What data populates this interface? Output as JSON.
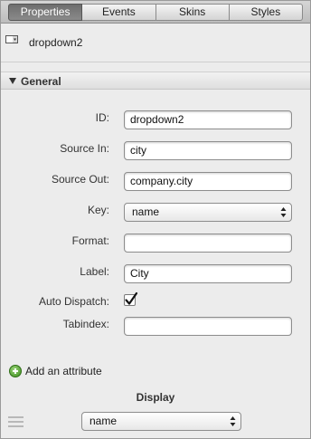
{
  "tabs": [
    {
      "label": "Properties",
      "active": true
    },
    {
      "label": "Events",
      "active": false
    },
    {
      "label": "Skins",
      "active": false
    },
    {
      "label": "Styles",
      "active": false
    }
  ],
  "component": {
    "icon": "dropdown-component-icon",
    "name": "dropdown2"
  },
  "section": {
    "title": "General",
    "expanded": true
  },
  "fields": {
    "id": {
      "label": "ID:",
      "value": "dropdown2"
    },
    "source_in": {
      "label": "Source In:",
      "value": "city"
    },
    "source_out": {
      "label": "Source Out:",
      "value": "company.city"
    },
    "key": {
      "label": "Key:",
      "value": "name"
    },
    "format": {
      "label": "Format:",
      "value": ""
    },
    "label": {
      "label": "Label:",
      "value": "City"
    },
    "auto_dispatch": {
      "label": "Auto Dispatch:",
      "checked": true
    },
    "tabindex": {
      "label": "Tabindex:",
      "value": ""
    }
  },
  "add_attribute": {
    "label": "Add an attribute",
    "icon": "add-circle-icon"
  },
  "display": {
    "title": "Display",
    "value": "name"
  },
  "colors": {
    "active_tab": "#777777",
    "add_icon": "#3c8c1c"
  }
}
